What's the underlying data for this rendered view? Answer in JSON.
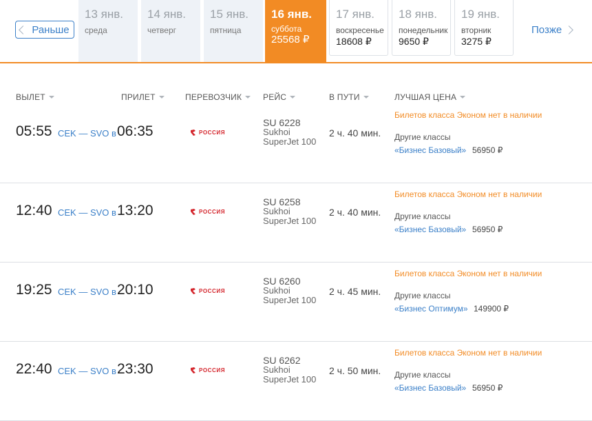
{
  "nav": {
    "prev_label": "Раньше",
    "next_label": "Позже"
  },
  "dates": [
    {
      "day": "13 янв.",
      "weekday": "среда",
      "price": ""
    },
    {
      "day": "14 янв.",
      "weekday": "четверг",
      "price": ""
    },
    {
      "day": "15 янв.",
      "weekday": "пятница",
      "price": ""
    },
    {
      "day": "16 янв.",
      "weekday": "суббота",
      "price": "25568 ₽"
    },
    {
      "day": "17 янв.",
      "weekday": "воскресенье",
      "price": "18608 ₽"
    },
    {
      "day": "18 янв.",
      "weekday": "понедельник",
      "price": "9650 ₽"
    },
    {
      "day": "19 янв.",
      "weekday": "вторник",
      "price": "3275 ₽"
    }
  ],
  "columns": {
    "departure": "ВЫЛЕТ",
    "arrival": "ПРИЛЕТ",
    "carrier": "ПЕРЕВОЗЧИК",
    "flight": "РЕЙС",
    "duration": "В ПУТИ",
    "best_price": "ЛУЧШАЯ ЦЕНА"
  },
  "flights": [
    {
      "dep": "05:55",
      "route": "CEK — SVO в",
      "arr": "06:35",
      "airline": "РОССИЯ",
      "number": "SU 6228",
      "aircraft1": "Sukhoi",
      "aircraft2": "SuperJet 100",
      "duration": "2 ч. 40 мин.",
      "unavailable": "Билетов класса Эконом нет в наличии",
      "other": "Другие классы",
      "fare": "«Бизнес Базовый»",
      "price": "56950 ₽"
    },
    {
      "dep": "12:40",
      "route": "CEK — SVO в",
      "arr": "13:20",
      "airline": "РОССИЯ",
      "number": "SU 6258",
      "aircraft1": "Sukhoi",
      "aircraft2": "SuperJet 100",
      "duration": "2 ч. 40 мин.",
      "unavailable": "Билетов класса Эконом нет в наличии",
      "other": "Другие классы",
      "fare": "«Бизнес Базовый»",
      "price": "56950 ₽"
    },
    {
      "dep": "19:25",
      "route": "CEK — SVO в",
      "arr": "20:10",
      "airline": "РОССИЯ",
      "number": "SU 6260",
      "aircraft1": "Sukhoi",
      "aircraft2": "SuperJet 100",
      "duration": "2 ч. 45 мин.",
      "unavailable": "Билетов класса Эконом нет в наличии",
      "other": "Другие классы",
      "fare": "«Бизнес Оптимум»",
      "price": "149900 ₽"
    },
    {
      "dep": "22:40",
      "route": "CEK — SVO в",
      "arr": "23:30",
      "airline": "РОССИЯ",
      "number": "SU 6262",
      "aircraft1": "Sukhoi",
      "aircraft2": "SuperJet 100",
      "duration": "2 ч. 50 мин.",
      "unavailable": "Билетов класса Эконом нет в наличии",
      "other": "Другие классы",
      "fare": "«Бизнес Базовый»",
      "price": "56950 ₽"
    }
  ],
  "colors": {
    "accent": "#f28b24",
    "link": "#3a7fc8",
    "airline_logo": "#d4252c"
  }
}
